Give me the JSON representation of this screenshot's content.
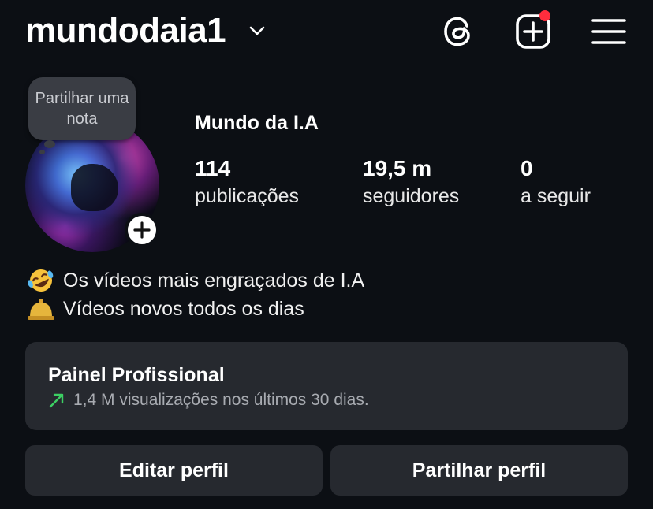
{
  "header": {
    "username": "mundodaia1",
    "icons": [
      "chevron-down-icon",
      "threads-icon",
      "create-icon",
      "menu-icon"
    ],
    "notification_color": "#ff2d3d"
  },
  "profile": {
    "note_placeholder": "Partilhar uma nota",
    "display_name": "Mundo da I.A",
    "stats": {
      "posts": {
        "value": "114",
        "label": "publicações"
      },
      "followers": {
        "value": "19,5 m",
        "label": "seguidores"
      },
      "following": {
        "value": "0",
        "label": "a seguir"
      }
    },
    "bio": [
      {
        "emoji": "rofl-emoji",
        "text": "Os vídeos mais engraçados de I.A"
      },
      {
        "emoji": "bell-emoji",
        "text": "Vídeos novos todos os dias"
      }
    ]
  },
  "dashboard": {
    "title": "Painel Profissional",
    "subtitle": "1,4 M visualizações nos últimos 30 dias.",
    "trend_color": "#3ccf63"
  },
  "actions": {
    "edit_label": "Editar perfil",
    "share_label": "Partilhar perfil"
  },
  "colors": {
    "background": "#0c0f14",
    "card": "#26292f"
  }
}
